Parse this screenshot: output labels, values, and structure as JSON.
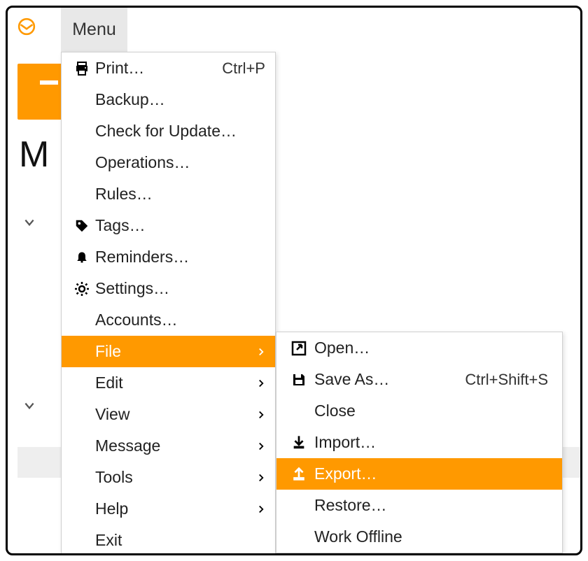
{
  "app": {
    "menu_label": "Menu",
    "accent": "#ff9900"
  },
  "background": {
    "partial_text": "M"
  },
  "menu": {
    "items": [
      {
        "label": "Print…",
        "icon": "printer-icon",
        "shortcut": "Ctrl+P"
      },
      {
        "label": "Backup…"
      },
      {
        "label": "Check for Update…"
      },
      {
        "label": "Operations…"
      },
      {
        "label": "Rules…"
      },
      {
        "label": "Tags…",
        "icon": "tag-icon"
      },
      {
        "label": "Reminders…",
        "icon": "bell-icon"
      },
      {
        "label": "Settings…",
        "icon": "gear-icon"
      },
      {
        "label": "Accounts…"
      },
      {
        "label": "File",
        "submenu": true,
        "highlight": true
      },
      {
        "label": "Edit",
        "submenu": true
      },
      {
        "label": "View",
        "submenu": true
      },
      {
        "label": "Message",
        "submenu": true
      },
      {
        "label": "Tools",
        "submenu": true
      },
      {
        "label": "Help",
        "submenu": true
      },
      {
        "label": "Exit"
      }
    ]
  },
  "submenu": {
    "items": [
      {
        "label": "Open…",
        "icon": "open-icon"
      },
      {
        "label": "Save As…",
        "icon": "save-icon",
        "shortcut": "Ctrl+Shift+S"
      },
      {
        "label": "Close"
      },
      {
        "label": "Import…",
        "icon": "import-icon"
      },
      {
        "label": "Export…",
        "icon": "export-icon",
        "highlight": true
      },
      {
        "label": "Restore…"
      },
      {
        "label": "Work Offline"
      }
    ]
  }
}
